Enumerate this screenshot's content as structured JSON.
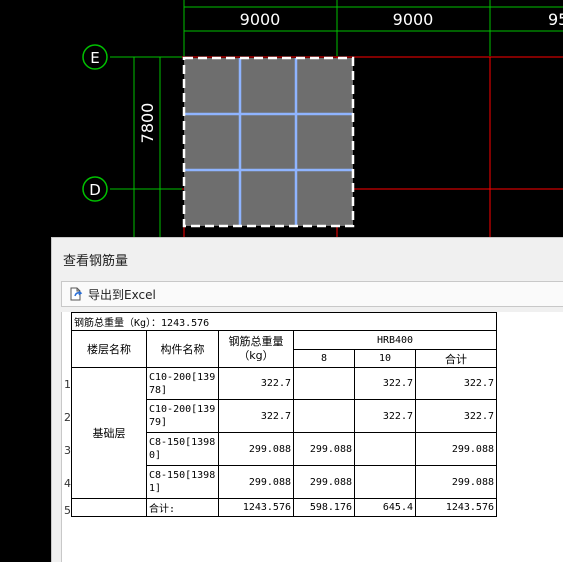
{
  "cad": {
    "dim_top": [
      "9000",
      "9000",
      "95"
    ],
    "dim_left": "7800",
    "axis_labels": [
      "E",
      "D"
    ],
    "colors": {
      "grid_red": "#ff0000",
      "grid_green": "#00c000",
      "selection_fill": "#6e6e6e",
      "rebar_blue": "#8fb4ff"
    }
  },
  "dialog": {
    "title": "查看钢筋量",
    "export_label": "导出到Excel",
    "export_icon": "export-excel-icon"
  },
  "table": {
    "summary": "钢筋总重量（Kg）：1243.576",
    "headers": {
      "floor": "楼层名称",
      "member": "构件名称",
      "total": "钢筋总重量（kg）",
      "grade": "HRB400",
      "d8": "8",
      "d10": "10",
      "subtotal": "合计"
    },
    "floor_name": "基础层",
    "row_numbers": [
      "1",
      "2",
      "3",
      "4",
      "5"
    ],
    "rows": [
      {
        "member": "C10-200[13978]",
        "total": "322.7",
        "d8": "",
        "d10": "322.7",
        "subtotal": "322.7"
      },
      {
        "member": "C10-200[13979]",
        "total": "322.7",
        "d8": "",
        "d10": "322.7",
        "subtotal": "322.7"
      },
      {
        "member": "C8-150[13980]",
        "total": "299.088",
        "d8": "299.088",
        "d10": "",
        "subtotal": "299.088"
      },
      {
        "member": "C8-150[13981]",
        "total": "299.088",
        "d8": "299.088",
        "d10": "",
        "subtotal": "299.088"
      }
    ],
    "total_row": {
      "member": "合计:",
      "total": "1243.576",
      "d8": "598.176",
      "d10": "645.4",
      "subtotal": "1243.576"
    }
  }
}
